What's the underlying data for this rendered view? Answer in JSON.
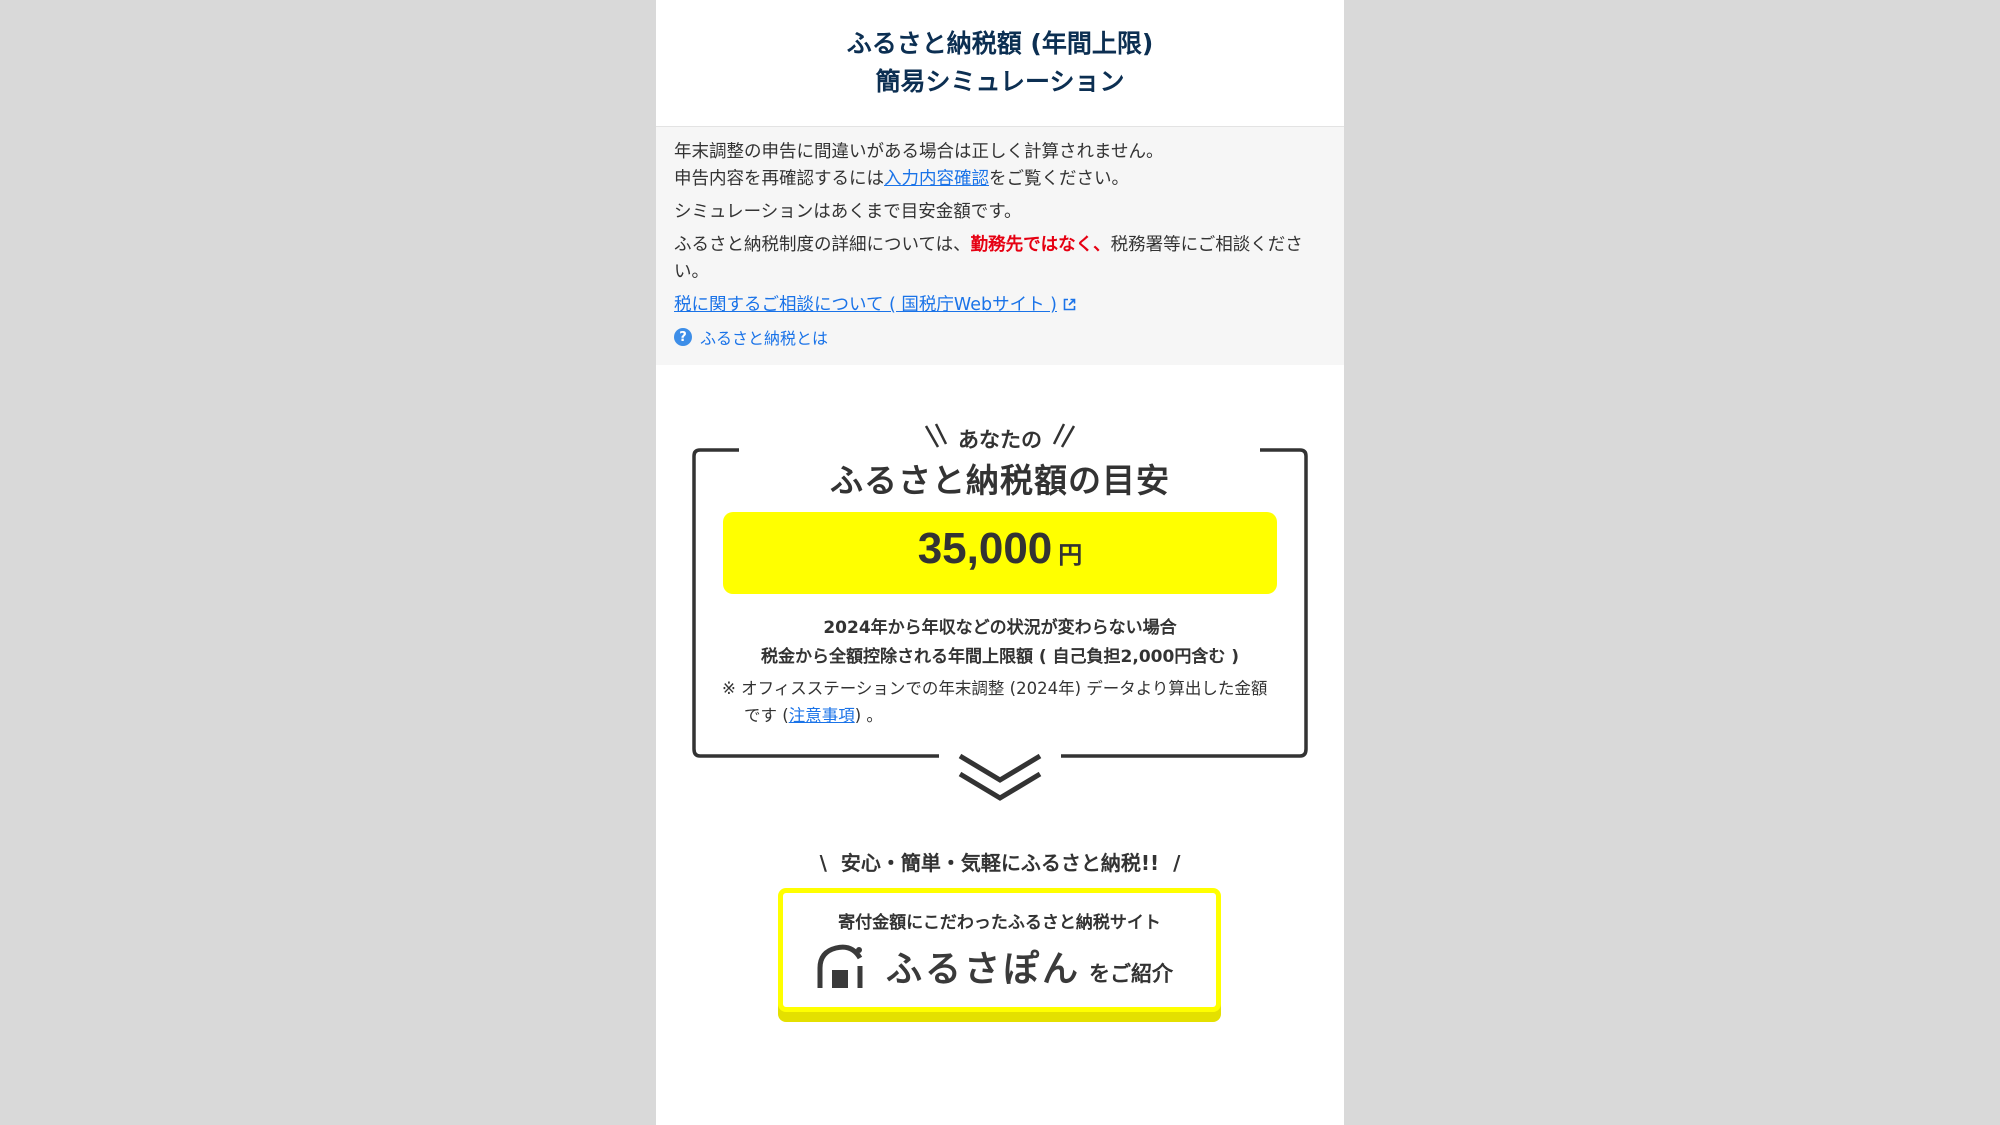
{
  "header": {
    "title_line1": "ふるさと納税額 (年間上限)",
    "title_line2": "簡易シミュレーション"
  },
  "notice": {
    "line1": "年末調整の申告に間違いがある場合は正しく計算されません。",
    "line2_prefix": "申告内容を再確認するには",
    "line2_link": "入力内容確認",
    "line2_suffix": "をご覧ください。",
    "line3": "シミュレーションはあくまで目安金額です。",
    "line4_prefix": "ふるさと納税制度の詳細については、",
    "line4_red": "勤務先ではなく、",
    "line4_suffix": "税務署等にご相談ください。",
    "tax_link": "税に関するご相談について ( 国税庁Webサイト )",
    "help_label": "ふるさと納税とは",
    "help_icon_glyph": "?"
  },
  "result": {
    "anata": "あなたの",
    "heading": "ふるさと納税額の目安",
    "amount": "35,000",
    "unit": "円",
    "condition_line1": "2024年から年収などの状況が変わらない場合",
    "condition_line2": "税金から全額控除される年間上限額 ( 自己負担2,000円含む )",
    "note_prefix": "※ オフィスステーションでの年末調整 (2024年) データより算出した金額",
    "note_line2_prefix": "です (",
    "note_link": "注意事項",
    "note_line2_suffix": ") 。"
  },
  "promo": {
    "catch_left": "\\",
    "catch_text": "安心・簡単・気軽にふるさと納税!!",
    "catch_right": "/",
    "banner_sub": "寄付金額にこだわったふるさと納税サイト",
    "banner_brand": "ふるさぽん",
    "banner_suffix": "をご紹介"
  },
  "colors": {
    "header_title": "#0c2f52",
    "link": "#1a73e8",
    "warning": "#e60012",
    "highlight": "#ffff00"
  }
}
